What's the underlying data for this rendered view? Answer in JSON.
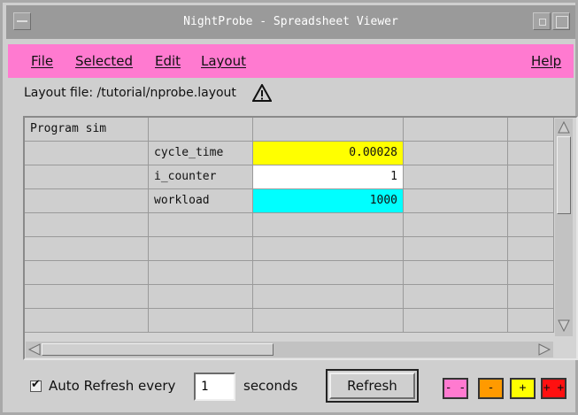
{
  "window": {
    "title": "NightProbe - Spreadsheet Viewer"
  },
  "menubar": {
    "items": [
      {
        "label": "File"
      },
      {
        "label": "Selected"
      },
      {
        "label": "Edit"
      },
      {
        "label": "Layout"
      }
    ],
    "help": "Help",
    "background": "#ff7ad0"
  },
  "layout_file": "Layout file: /tutorial/nprobe.layout",
  "warning_icon": "warning-triangle-icon",
  "table": {
    "rows": [
      [
        "Program sim",
        "",
        "",
        "",
        ""
      ],
      [
        "",
        "cycle_time",
        "0.00028",
        "",
        ""
      ],
      [
        "",
        "i_counter",
        "1",
        "",
        ""
      ],
      [
        "",
        "workload",
        "1000",
        "",
        ""
      ],
      [
        "",
        "",
        "",
        "",
        ""
      ],
      [
        "",
        "",
        "",
        "",
        ""
      ],
      [
        "",
        "",
        "",
        "",
        ""
      ],
      [
        "",
        "",
        "",
        "",
        ""
      ],
      [
        "",
        "",
        "",
        "",
        ""
      ]
    ],
    "value_colors": [
      "#ffff00",
      "#ffffff",
      "#00ffff"
    ]
  },
  "controls": {
    "auto_refresh_checked": true,
    "auto_refresh_label": "Auto Refresh every",
    "interval_value": "1",
    "seconds_label": "seconds",
    "refresh_label": "Refresh",
    "adjust_buttons": [
      {
        "label": "- -",
        "color": "#ff7ad0"
      },
      {
        "label": "-",
        "color": "#ff9a00"
      },
      {
        "label": "+",
        "color": "#ffff00"
      },
      {
        "label": "+ +",
        "color": "#ff1010"
      }
    ]
  }
}
